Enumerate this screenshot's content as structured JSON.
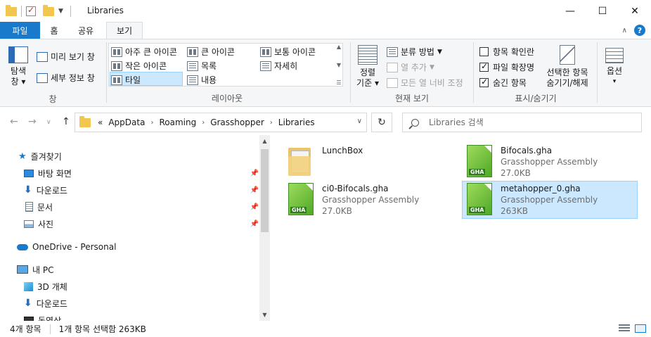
{
  "window": {
    "title": "Libraries",
    "minimize": "—",
    "maximize": "☐",
    "close": "✕"
  },
  "ribbon_tabs": {
    "file": "파일",
    "home": "홈",
    "share": "공유",
    "view": "보기"
  },
  "ribbon": {
    "panes": {
      "nav_pane_l1": "탐색",
      "nav_pane_l2": "창",
      "preview": "미리 보기 창",
      "details": "세부 정보 창",
      "label": "창"
    },
    "layout": {
      "extra_large": "아주 큰 아이콘",
      "large": "큰 아이콘",
      "medium": "보통 아이콘",
      "small": "작은 아이콘",
      "list": "목록",
      "details": "자세히",
      "tiles": "타일",
      "content": "내용",
      "label": "레이아웃"
    },
    "current_view": {
      "sort_l1": "정렬",
      "sort_l2": "기준",
      "group_by": "분류 방법",
      "add_columns": "열 추가",
      "size_columns": "모든 열 너비 조정",
      "label": "현재 보기"
    },
    "show_hide": {
      "item_checkboxes": "항목 확인란",
      "file_extensions": "파일 확장명",
      "hidden_items": "숨긴 항목",
      "hide_selected_l1": "선택한 항목",
      "hide_selected_l2": "숨기기/해제",
      "label": "표시/숨기기"
    },
    "options": "옵션"
  },
  "address": {
    "overflow": "«",
    "crumbs": [
      "AppData",
      "Roaming",
      "Grasshopper",
      "Libraries"
    ],
    "search_placeholder": "Libraries 검색"
  },
  "nav_pane": {
    "quick_access": "즐겨찾기",
    "desktop": "바탕 화면",
    "downloads": "다운로드",
    "documents": "문서",
    "pictures": "사진",
    "onedrive": "OneDrive - Personal",
    "this_pc": "내 PC",
    "objects3d": "3D 개체",
    "downloads2": "다운로드",
    "videos": "동영상"
  },
  "files": [
    {
      "name": "LunchBox",
      "type": "",
      "size": "",
      "icon": "folder"
    },
    {
      "name": "Bifocals.gha",
      "type": "Grasshopper Assembly",
      "size": "27.0KB",
      "icon": "gha"
    },
    {
      "name": "ci0-Bifocals.gha",
      "type": "Grasshopper Assembly",
      "size": "27.0KB",
      "icon": "gha"
    },
    {
      "name": "metahopper_0.gha",
      "type": "Grasshopper Assembly",
      "size": "263KB",
      "icon": "gha",
      "selected": true
    }
  ],
  "gha_label": "GHA",
  "status": {
    "count": "4개 항목",
    "selection": "1개 항목 선택함 263KB"
  }
}
